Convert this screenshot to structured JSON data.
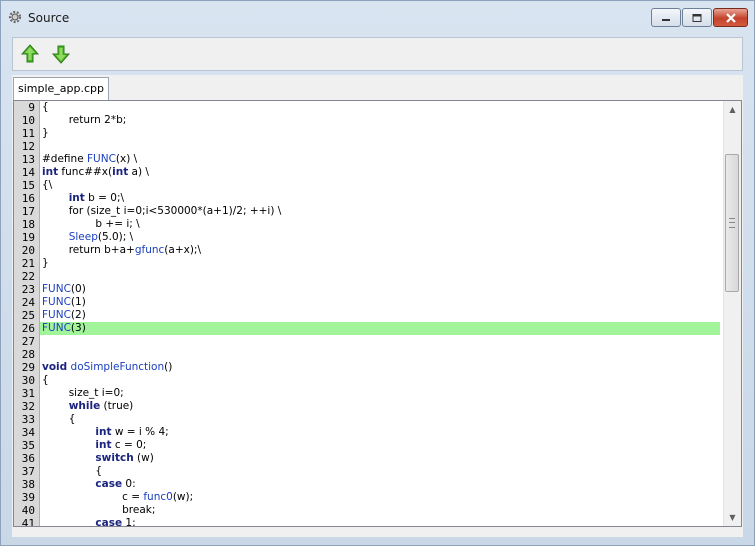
{
  "window": {
    "title": "Source"
  },
  "toolbar": {
    "up_icon": "green-up-arrow-icon",
    "down_icon": "green-down-arrow-icon"
  },
  "tabs": [
    {
      "label": "simple_app.cpp"
    }
  ],
  "editor": {
    "highlight_color": "#a2f49b",
    "lines": [
      {
        "n": "9",
        "html": "{"
      },
      {
        "n": "10",
        "html": "        return 2*b;"
      },
      {
        "n": "11",
        "html": "}"
      },
      {
        "n": "12",
        "html": ""
      },
      {
        "n": "13",
        "html": "#define <span class=\"fn\">FUNC</span>(x) \\"
      },
      {
        "n": "14",
        "html": "<span class=\"kw\">int</span> func##x(<span class=\"kw\">int</span> a) \\"
      },
      {
        "n": "15",
        "html": "{\\"
      },
      {
        "n": "16",
        "html": "        <span class=\"kw\">int</span> b = 0;\\"
      },
      {
        "n": "17",
        "html": "        for (size_t i=0;i&lt;530000*(a+1)/2; ++i) \\"
      },
      {
        "n": "18",
        "html": "                b += i; \\"
      },
      {
        "n": "19",
        "html": "        <span class=\"fn\">Sleep</span>(5.0); \\"
      },
      {
        "n": "20",
        "html": "        return b+a+<span class=\"fn\">gfunc</span>(a+x);\\"
      },
      {
        "n": "21",
        "html": "}"
      },
      {
        "n": "22",
        "html": ""
      },
      {
        "n": "23",
        "html": "<span class=\"fn\">FUNC</span>(0)"
      },
      {
        "n": "24",
        "html": "<span class=\"fn\">FUNC</span>(1)"
      },
      {
        "n": "25",
        "html": "<span class=\"fn\">FUNC</span>(2)"
      },
      {
        "n": "26",
        "html": "<span class=\"fn\">FUNC</span>(3)",
        "hl": true
      },
      {
        "n": "27",
        "html": ""
      },
      {
        "n": "28",
        "html": ""
      },
      {
        "n": "29",
        "html": "<span class=\"kw\">void</span> <span class=\"fn\">doSimpleFunction</span>()"
      },
      {
        "n": "30",
        "html": "{"
      },
      {
        "n": "31",
        "html": "        size_t i=0;"
      },
      {
        "n": "32",
        "html": "        <span class=\"kw\">while</span> (true)"
      },
      {
        "n": "33",
        "html": "        {"
      },
      {
        "n": "34",
        "html": "                <span class=\"kw\">int</span> w = i % 4;"
      },
      {
        "n": "35",
        "html": "                <span class=\"kw\">int</span> c = 0;"
      },
      {
        "n": "36",
        "html": "                <span class=\"kw\">switch</span> (w)"
      },
      {
        "n": "37",
        "html": "                {"
      },
      {
        "n": "38",
        "html": "                <span class=\"kw\">case</span> 0:"
      },
      {
        "n": "39",
        "html": "                        c = <span class=\"fn\">func0</span>(w);"
      },
      {
        "n": "40",
        "html": "                        break;"
      },
      {
        "n": "41",
        "html": "                <span class=\"kw\">case</span> 1:"
      }
    ]
  }
}
